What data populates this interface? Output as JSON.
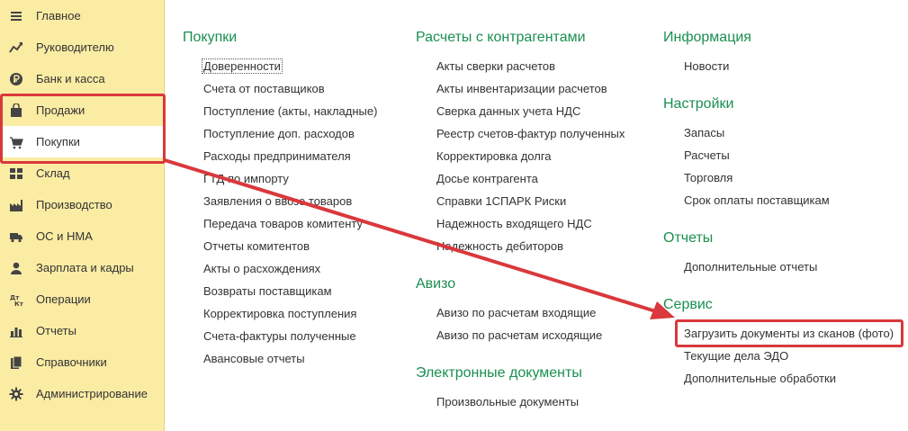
{
  "sidebar": {
    "items": [
      {
        "label": "Главное",
        "icon": "hamburger-menu-icon"
      },
      {
        "label": "Руководителю",
        "icon": "trend-chart-icon"
      },
      {
        "label": "Банк и касса",
        "icon": "ruble-coin-icon"
      },
      {
        "label": "Продажи",
        "icon": "shopping-bag-icon"
      },
      {
        "label": "Покупки",
        "icon": "shopping-cart-icon"
      },
      {
        "label": "Склад",
        "icon": "warehouse-grid-icon"
      },
      {
        "label": "Производство",
        "icon": "factory-icon"
      },
      {
        "label": "ОС и НМА",
        "icon": "truck-icon"
      },
      {
        "label": "Зарплата и кадры",
        "icon": "person-icon"
      },
      {
        "label": "Операции",
        "icon": "debit-credit-icon"
      },
      {
        "label": "Отчеты",
        "icon": "bar-chart-icon"
      },
      {
        "label": "Справочники",
        "icon": "books-icon"
      },
      {
        "label": "Администрирование",
        "icon": "gear-icon"
      }
    ],
    "active_item": "Покупки"
  },
  "columns": {
    "purchases": {
      "title": "Покупки",
      "links": [
        "Доверенности",
        "Счета от поставщиков",
        "Поступление (акты, накладные)",
        "Поступление доп. расходов",
        "Расходы предпринимателя",
        "ГТД по импорту",
        "Заявления о ввозе товаров",
        "Передача товаров комитенту",
        "Отчеты комитентов",
        "Акты о расхождениях",
        "Возвраты поставщикам",
        "Корректировка поступления",
        "Счета-фактуры полученные",
        "Авансовые отчеты"
      ]
    },
    "settlements": {
      "title": "Расчеты с контрагентами",
      "links": [
        "Акты сверки расчетов",
        "Акты инвентаризации расчетов",
        "Сверка данных учета НДС",
        "Реестр счетов-фактур полученных",
        "Корректировка долга",
        "Досье контрагента",
        "Справки 1СПАРК Риски",
        "Надежность входящего НДС",
        "Надежность дебиторов"
      ]
    },
    "aviso": {
      "title": "Авизо",
      "links": [
        "Авизо по расчетам входящие",
        "Авизо по расчетам исходящие"
      ]
    },
    "edocs": {
      "title": "Электронные документы",
      "links": [
        "Произвольные документы"
      ]
    },
    "info": {
      "title": "Информация",
      "links": [
        "Новости"
      ]
    },
    "settings": {
      "title": "Настройки",
      "links": [
        "Запасы",
        "Расчеты",
        "Торговля",
        "Срок оплаты поставщикам"
      ]
    },
    "reports": {
      "title": "Отчеты",
      "links": [
        "Дополнительные отчеты"
      ]
    },
    "service": {
      "title": "Сервис",
      "links": [
        "Загрузить документы из сканов (фото)",
        "Текущие дела ЭДО",
        "Дополнительные обработки"
      ]
    }
  },
  "colors": {
    "sidebar_bg": "#fbeca4",
    "section_title": "#1a8f50",
    "annotation_red": "#d9383c"
  }
}
